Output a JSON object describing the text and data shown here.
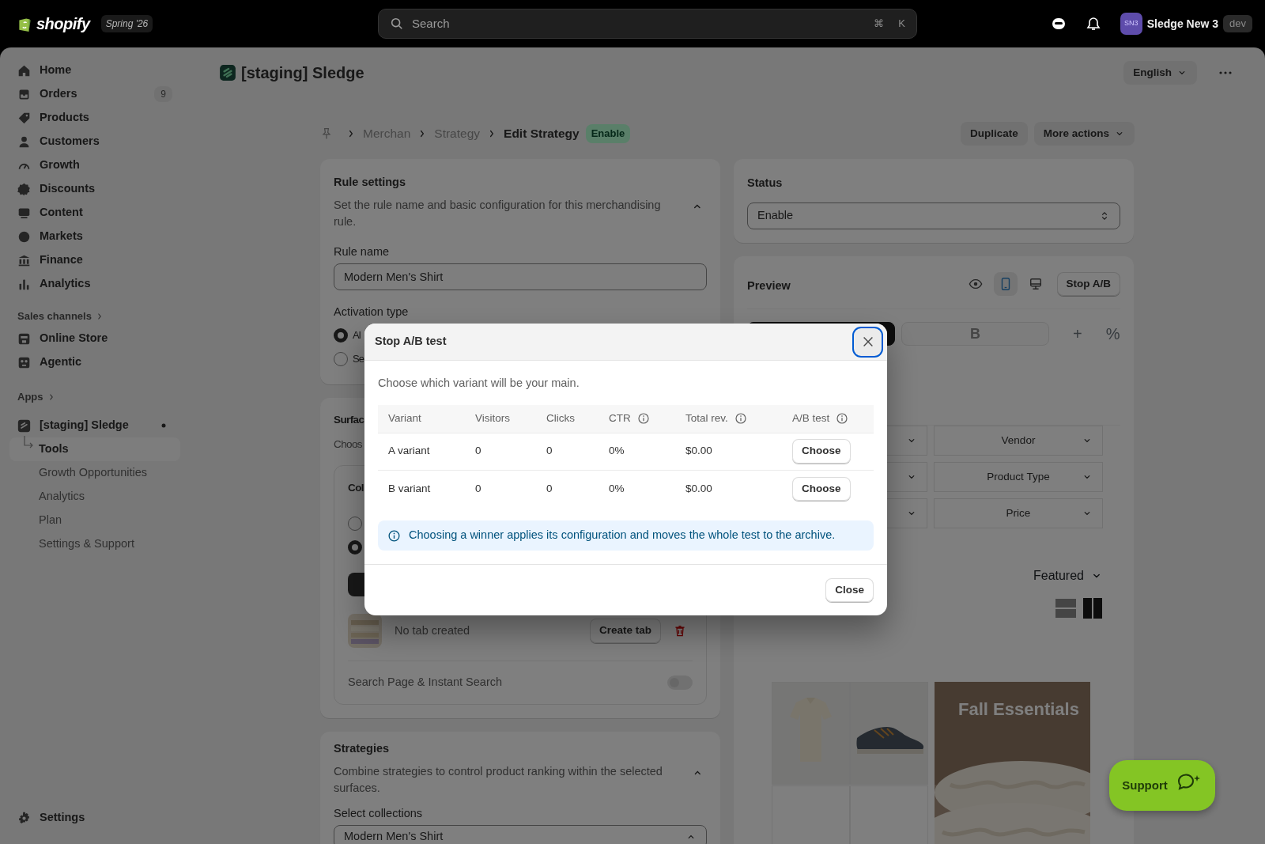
{
  "top_bar": {
    "brand": "shopify",
    "edition": "Spring '26",
    "search": {
      "placeholder": "Search",
      "shortcut": [
        "⌘",
        "K"
      ]
    },
    "account": {
      "initials": "SN3",
      "name": "Sledge New 3",
      "environment": "dev"
    }
  },
  "sidebar": {
    "items": [
      {
        "label": "Home"
      },
      {
        "label": "Orders",
        "badge": "9"
      },
      {
        "label": "Products"
      },
      {
        "label": "Customers"
      },
      {
        "label": "Growth"
      },
      {
        "label": "Discounts"
      },
      {
        "label": "Content"
      },
      {
        "label": "Markets"
      },
      {
        "label": "Finance"
      },
      {
        "label": "Analytics"
      }
    ],
    "sales_channels": {
      "heading": "Sales channels",
      "items": [
        {
          "label": "Online Store"
        },
        {
          "label": "Agentic"
        }
      ]
    },
    "apps": {
      "heading": "Apps",
      "app": {
        "label": "[staging] Sledge",
        "children": [
          {
            "label": "Tools",
            "selected": true
          },
          {
            "label": "Growth Opportunities",
            "selected": false
          },
          {
            "label": "Analytics",
            "selected": false
          },
          {
            "label": "Plan",
            "selected": false
          },
          {
            "label": "Settings & Support",
            "selected": false
          }
        ]
      }
    },
    "footer_item": {
      "label": "Settings"
    }
  },
  "page": {
    "title": "[staging] Sledge",
    "language": "English"
  },
  "breadcrumb": {
    "items": [
      "Merchan",
      "Strategy"
    ],
    "current": "Edit Strategy",
    "badge": "Enable",
    "actions": [
      "Duplicate",
      "More actions"
    ]
  },
  "rule_settings": {
    "title": "Rule settings",
    "description": "Set the rule name and basic configuration for this merchandising rule.",
    "expanded": true,
    "rule_name": {
      "label": "Rule name",
      "value": "Modern Men's Shirt"
    },
    "activation_type": {
      "label": "Activation type",
      "options": [
        {
          "label": "Al",
          "selected": true
        },
        {
          "label": "Se",
          "selected": false
        }
      ]
    }
  },
  "surfaces": {
    "title": "Surfac",
    "description": "Choos",
    "section": {
      "title": "Col",
      "options": [
        {
          "selected": false
        },
        {
          "selected": true
        }
      ],
      "tab_status": "No tab created",
      "tab_button": "Create tab",
      "toggle": {
        "label": "Search Page & Instant Search",
        "on": false
      }
    }
  },
  "strategies": {
    "title": "Strategies",
    "description": "Combine strategies to control product ranking within the selected surfaces.",
    "expanded": true,
    "collections": {
      "label": "Select collections",
      "value": "Modern Men's Shirt"
    }
  },
  "status": {
    "title": "Status",
    "value": "Enable"
  },
  "preview": {
    "title": "Preview",
    "view_modes": [
      {
        "kind": "eye",
        "selected": false
      },
      {
        "kind": "mobile",
        "selected": true
      },
      {
        "kind": "desktop",
        "selected": false
      }
    ],
    "stop_button": "Stop A/B",
    "variant_tabs": [
      {
        "selected": true
      },
      {
        "label": "B",
        "selected": false
      }
    ],
    "tab_actions": [
      "+",
      "%"
    ],
    "filters": [
      "Vendor",
      "Product Type",
      "Price"
    ],
    "sort": "Featured",
    "layouts": [
      {
        "kind": "rows",
        "selected": false
      },
      {
        "kind": "columns",
        "selected": true
      }
    ],
    "banner": {
      "title": "Fall Essentials"
    }
  },
  "support": {
    "label": "Support"
  },
  "modal": {
    "title": "Stop A/B test",
    "close_focused": true,
    "message": "Choose which variant will be your main.",
    "columns": [
      {
        "label": "Variant",
        "info": false
      },
      {
        "label": "Visitors",
        "info": false
      },
      {
        "label": "Clicks",
        "info": false
      },
      {
        "label": "CTR",
        "info": true
      },
      {
        "label": "Total rev.",
        "info": true
      },
      {
        "label": "A/B test",
        "info": true
      }
    ],
    "rows": [
      {
        "cells": [
          "A variant",
          "0",
          "0",
          "0%",
          "$0.00"
        ],
        "action": "Choose"
      },
      {
        "cells": [
          "B variant",
          "0",
          "0",
          "0%",
          "$0.00"
        ],
        "action": "Choose"
      }
    ],
    "notice": "Choosing a winner applies its configuration and moves the whole test to the archive.",
    "buttons": [
      "Close"
    ]
  }
}
